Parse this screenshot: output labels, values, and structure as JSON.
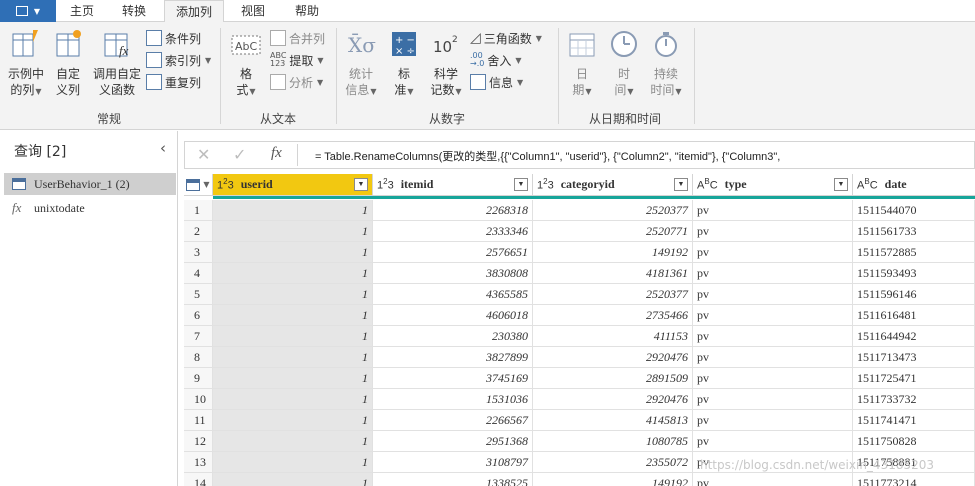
{
  "tabs": [
    "主页",
    "转换",
    "添加列",
    "视图",
    "帮助"
  ],
  "ribbon": {
    "general": {
      "group_label": "常规",
      "example_cols": [
        "示例中",
        "的列"
      ],
      "custom_col": [
        "自定",
        "义列"
      ],
      "invoke_func": [
        "调用自定",
        "义函数"
      ],
      "small": [
        "条件列",
        "索引列",
        "重复列"
      ]
    },
    "text": {
      "group_label": "从文本",
      "format": [
        "格",
        "式"
      ],
      "small": [
        "合并列",
        "提取",
        "分析"
      ]
    },
    "number": {
      "group_label": "从数字",
      "statistics": [
        "统计",
        "信息"
      ],
      "standard": [
        "标",
        "准"
      ],
      "scientific": [
        "科学",
        "记数"
      ],
      "small": [
        "三角函数",
        "舍入",
        "信息"
      ]
    },
    "datetime": {
      "group_label": "从日期和时间",
      "date": [
        "日",
        "期"
      ],
      "time": [
        "时",
        "间"
      ],
      "duration": [
        "持续",
        "时间"
      ]
    }
  },
  "query_pane": {
    "title": "查询 [2]",
    "items": [
      "UserBehavior_1 (2)",
      "unixtodate"
    ]
  },
  "formula": "= Table.RenameColumns(更改的类型,{{\"Column1\", \"userid\"}, {\"Column2\", \"itemid\"}, {\"Column3\",",
  "columns": [
    {
      "type": "123",
      "name": "userid"
    },
    {
      "type": "123",
      "name": "itemid"
    },
    {
      "type": "123",
      "name": "categoryid"
    },
    {
      "type": "ABC",
      "name": "type"
    },
    {
      "type": "ABC",
      "name": "date"
    }
  ],
  "rows": [
    [
      "1",
      "1",
      "2268318",
      "2520377",
      "pv",
      "1511544070"
    ],
    [
      "2",
      "1",
      "2333346",
      "2520771",
      "pv",
      "1511561733"
    ],
    [
      "3",
      "1",
      "2576651",
      "149192",
      "pv",
      "1511572885"
    ],
    [
      "4",
      "1",
      "3830808",
      "4181361",
      "pv",
      "1511593493"
    ],
    [
      "5",
      "1",
      "4365585",
      "2520377",
      "pv",
      "1511596146"
    ],
    [
      "6",
      "1",
      "4606018",
      "2735466",
      "pv",
      "1511616481"
    ],
    [
      "7",
      "1",
      "230380",
      "411153",
      "pv",
      "1511644942"
    ],
    [
      "8",
      "1",
      "3827899",
      "2920476",
      "pv",
      "1511713473"
    ],
    [
      "9",
      "1",
      "3745169",
      "2891509",
      "pv",
      "1511725471"
    ],
    [
      "10",
      "1",
      "1531036",
      "2920476",
      "pv",
      "1511733732"
    ],
    [
      "11",
      "1",
      "2266567",
      "4145813",
      "pv",
      "1511741471"
    ],
    [
      "12",
      "1",
      "2951368",
      "1080785",
      "pv",
      "1511750828"
    ],
    [
      "13",
      "1",
      "3108797",
      "2355072",
      "pv",
      "1511758881"
    ],
    [
      "14",
      "1",
      "1338525",
      "149192",
      "pv",
      "1511773214"
    ]
  ],
  "watermark": "https://blog.csdn.net/weixin_43185203"
}
